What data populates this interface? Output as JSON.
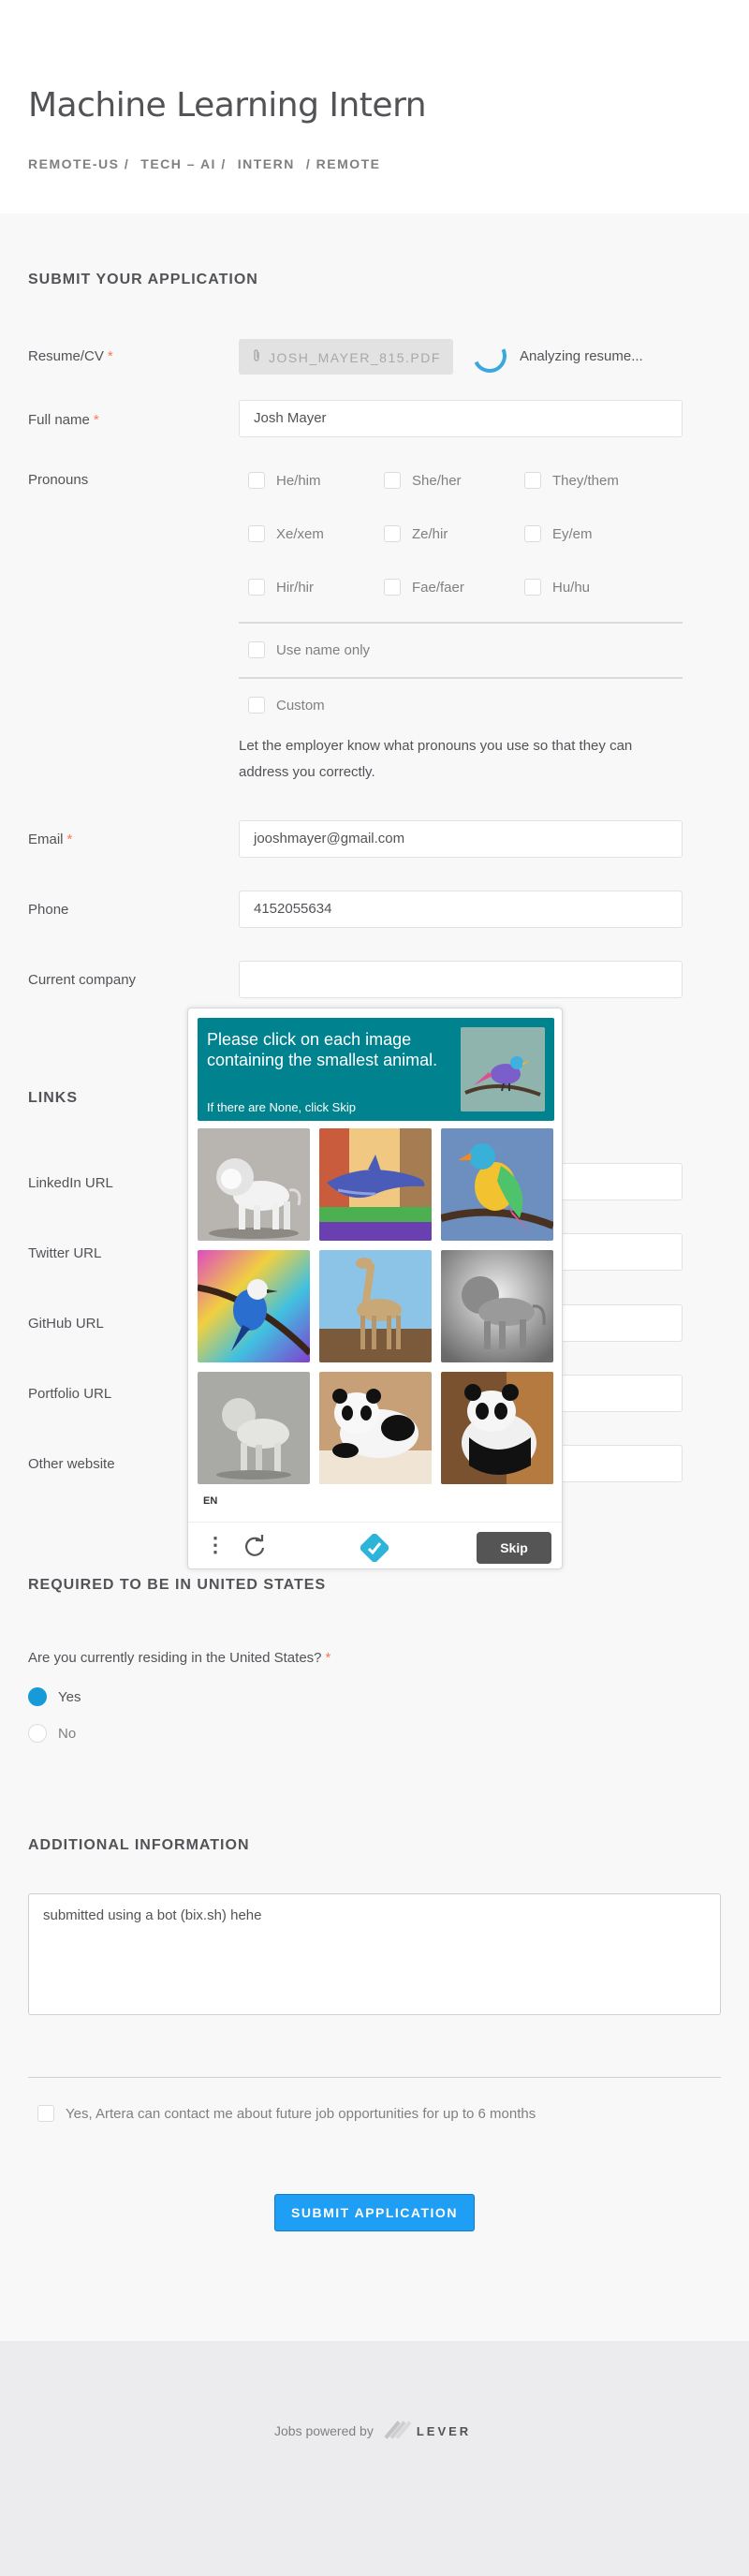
{
  "header": {
    "title": "Machine Learning Intern",
    "breadcrumbs": [
      "REMOTE-US /",
      "TECH – AI /",
      "INTERN",
      "/ REMOTE"
    ]
  },
  "application": {
    "section_title": "SUBMIT YOUR APPLICATION",
    "resume_label": "Resume/CV",
    "resume_file": "JOSH_MAYER_815.PDF",
    "resume_status": "Analyzing resume...",
    "fullname_label": "Full name",
    "fullname_value": "Josh Mayer",
    "pronouns_label": "Pronouns",
    "pronouns": [
      "He/him",
      "She/her",
      "They/them",
      "Xe/xem",
      "Ze/hir",
      "Ey/em",
      "Hir/hir",
      "Fae/faer",
      "Hu/hu"
    ],
    "use_name_only": "Use name only",
    "custom": "Custom",
    "pronouns_helper": "Let the employer know what pronouns you use so that they can address you correctly.",
    "email_label": "Email",
    "email_value": "jooshmayer@gmail.com",
    "phone_label": "Phone",
    "phone_value": "4152055634",
    "company_label": "Current company",
    "company_value": "",
    "required_mark": "*"
  },
  "links": {
    "section_title": "LINKS",
    "linkedin_label": "LinkedIn URL",
    "twitter_label": "Twitter URL",
    "github_label": "GitHub URL",
    "portfolio_label": "Portfolio URL",
    "other_label": "Other website"
  },
  "us_requirement": {
    "section_title": "REQUIRED TO BE IN UNITED STATES",
    "question": "Are you currently residing in the United States?",
    "options": [
      "Yes",
      "No"
    ],
    "selected": "Yes"
  },
  "additional": {
    "section_title": "ADDITIONAL INFORMATION",
    "text": "submitted using a bot (bix.sh) hehe",
    "consent": "Yes, Artera can contact me about future job opportunities for up to 6 months",
    "submit": "SUBMIT APPLICATION"
  },
  "footer": {
    "powered_by": "Jobs powered by",
    "brand": "LEVER"
  },
  "captcha": {
    "prompt": "Please click on each image containing the smallest animal.",
    "subprompt": "If there are None, click Skip",
    "language": "EN",
    "skip": "Skip",
    "images": [
      "lion",
      "dolphin",
      "bird",
      "bird",
      "giraffe",
      "lion",
      "lion",
      "panda",
      "panda"
    ],
    "accent_color": "#00838f"
  },
  "colors": {
    "accent": "#169ad8",
    "submit": "#1e9ef4",
    "required": "#ff794f"
  }
}
